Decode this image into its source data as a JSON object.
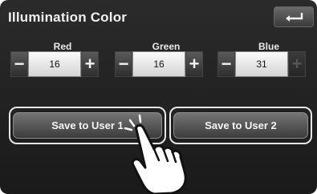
{
  "title": "Illumination Color",
  "controls": [
    {
      "label": "Red",
      "value": "16",
      "minus": "−",
      "plus": "+",
      "plus_enabled": true
    },
    {
      "label": "Green",
      "value": "16",
      "minus": "−",
      "plus": "+",
      "plus_enabled": true
    },
    {
      "label": "Blue",
      "value": "31",
      "minus": "−",
      "plus": "+",
      "plus_enabled": false
    }
  ],
  "buttons": {
    "save_user1": "Save to User 1",
    "save_user2": "Save to User 2"
  },
  "icons": {
    "back": "return-arrow-icon",
    "hand": "pointing-hand-icon"
  }
}
